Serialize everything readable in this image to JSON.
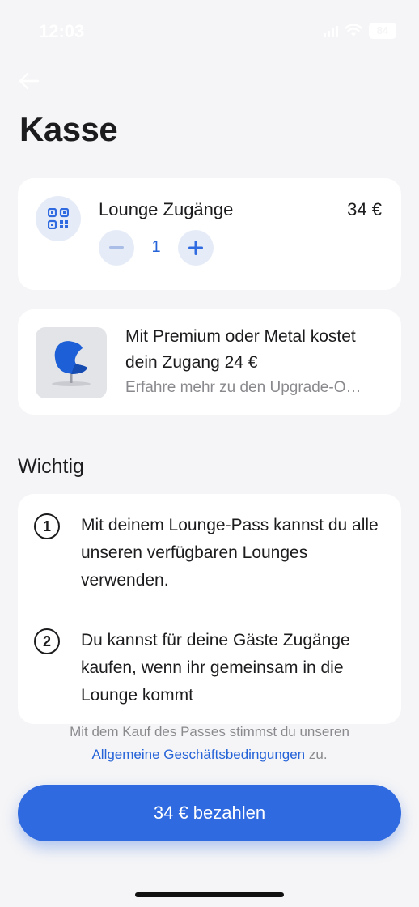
{
  "status_bar": {
    "time": "12:03",
    "battery": "84"
  },
  "page": {
    "title": "Kasse"
  },
  "lounge": {
    "title": "Lounge Zugänge",
    "price": "34 €",
    "quantity": "1"
  },
  "premium": {
    "title": "Mit Premium oder Metal kostet dein Zugang 24 €",
    "link": "Erfahre mehr zu den Upgrade-O…"
  },
  "important": {
    "title": "Wichtig",
    "items": [
      {
        "number": "1",
        "text": "Mit deinem Lounge-Pass kannst du alle unseren verfügbaren Lounges verwenden."
      },
      {
        "number": "2",
        "text": "Du kannst für deine Gäste Zugänge kaufen, wenn ihr gemeinsam in die Lounge kommt"
      }
    ]
  },
  "terms": {
    "prefix": "Mit dem Kauf des Passes stimmst du unseren",
    "link": "Allgemeine Geschäftsbedingungen",
    "suffix": " zu."
  },
  "pay_button": {
    "label": "34 € bezahlen"
  },
  "colors": {
    "accent": "#2f6ae0",
    "link": "#2563d8",
    "background": "#f5f5f7"
  },
  "icons": [
    "back-arrow-icon",
    "qr-code-icon",
    "minus-icon",
    "plus-icon",
    "chair-image",
    "wifi-icon",
    "signal-icon"
  ]
}
